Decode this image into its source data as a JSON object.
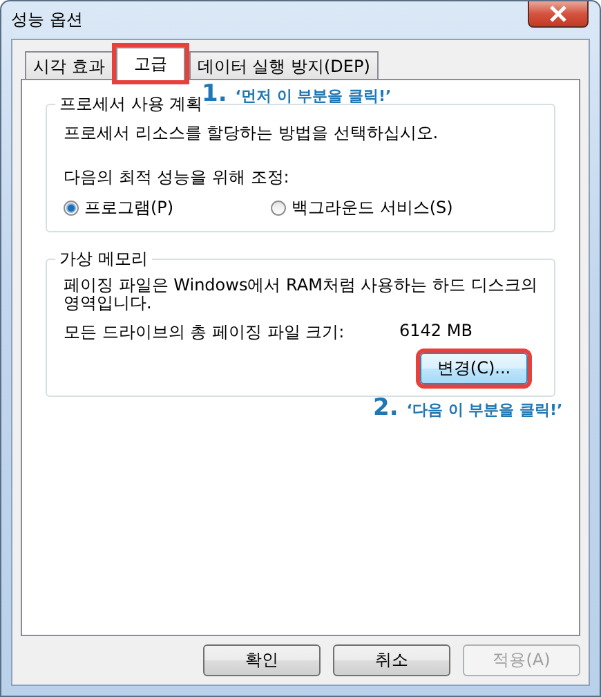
{
  "window": {
    "title": "성능 옵션"
  },
  "tabs": [
    {
      "label": "시각 효과",
      "selected": false,
      "highlighted": false
    },
    {
      "label": "고급",
      "selected": true,
      "highlighted": true
    },
    {
      "label": "데이터 실행 방지(DEP)",
      "selected": false,
      "highlighted": false
    }
  ],
  "processor_scheduling": {
    "title": "프로세서 사용 계획",
    "description": "프로세서 리소스를 할당하는 방법을 선택하십시오.",
    "adjust_label": "다음의 최적 성능을 위해 조정:",
    "options": [
      {
        "label": "프로그램(P)",
        "selected": true
      },
      {
        "label": "백그라운드 서비스(S)",
        "selected": false
      }
    ]
  },
  "virtual_memory": {
    "title": "가상 메모리",
    "description": "페이징 파일은 Windows에서 RAM처럼 사용하는 하드 디스크의 영역입니다.",
    "total_label": "모든 드라이브의 총 페이징 파일 크기:",
    "total_value": "6142 MB",
    "change_button": {
      "label": "변경(C)...",
      "highlighted": true
    }
  },
  "annotations": [
    {
      "number": "1.",
      "text": "‘먼저 이 부분을 클릭!’"
    },
    {
      "number": "2.",
      "text": "‘다음 이 부분을 클릭!’"
    }
  ],
  "buttons": [
    {
      "label": "확인",
      "disabled": false
    },
    {
      "label": "취소",
      "disabled": false
    },
    {
      "label": "적용(A)",
      "disabled": true
    }
  ]
}
